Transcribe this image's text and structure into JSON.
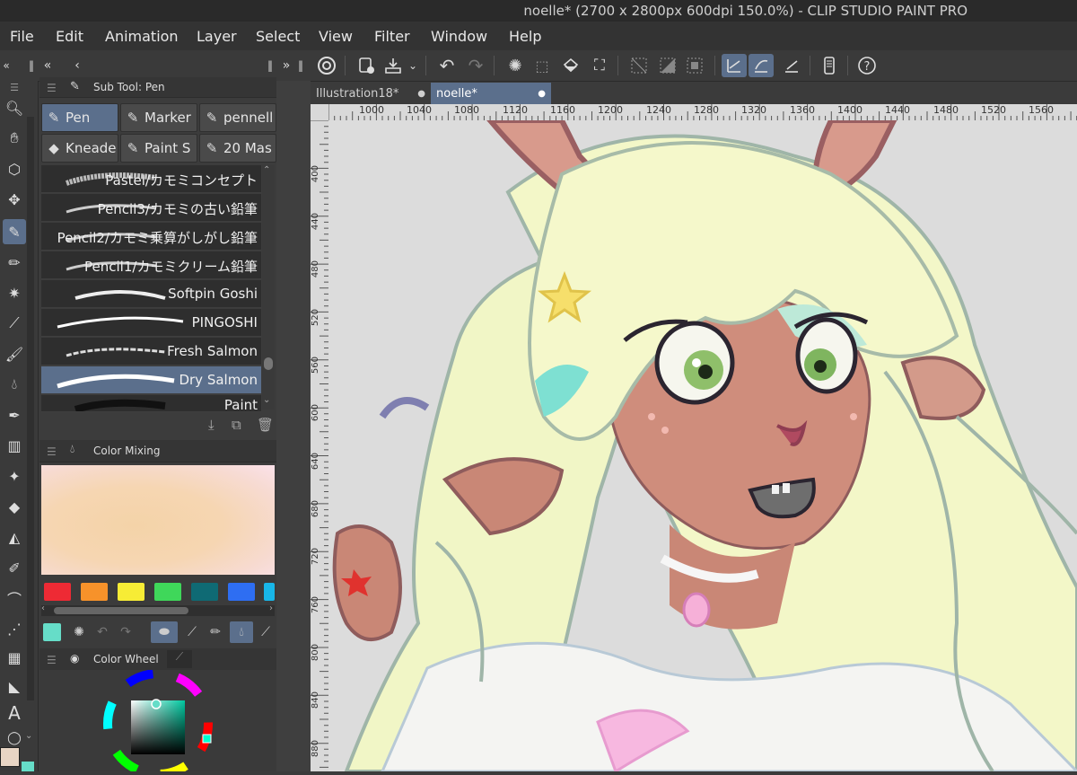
{
  "window": {
    "title": "noelle* (2700 x 2800px 600dpi 150.0%)  - CLIP STUDIO PAINT PRO"
  },
  "menu": [
    "File",
    "Edit",
    "Animation",
    "Layer",
    "Select",
    "View",
    "Filter",
    "Window",
    "Help"
  ],
  "subtool_panel": {
    "title": "Sub Tool: Pen",
    "tabs": [
      "Pen",
      "Marker",
      "pennell",
      "Kneade",
      "Paint S",
      "20 Mas"
    ],
    "brushes": [
      "Pastel/カモミコンセプト",
      "Pencil3/カモミの古い鉛筆",
      "Pencil2/カモミ乗算がしがし鉛筆",
      "Pencil1/カモミクリーム鉛筆",
      "Softpin Goshi",
      "PINGOSHI",
      "Fresh Salmon",
      "Dry Salmon",
      "Paint"
    ],
    "active_brush": "Dry Salmon"
  },
  "color_mixing": {
    "title": "Color Mixing",
    "swatches": [
      "#ee2a34",
      "#f7922a",
      "#f7ec35",
      "#3fd75a",
      "#0f6a74",
      "#2e6ef2",
      "#18b6e8"
    ]
  },
  "color_wheel": {
    "title": "Color Wheel"
  },
  "document_tabs": [
    "Illustration18*",
    "noelle*"
  ],
  "active_document": "noelle*",
  "ruler_top": [
    "1000",
    "1040",
    "1080",
    "1120",
    "1160",
    "1200",
    "1240",
    "1280",
    "1320",
    "1360",
    "1400",
    "1440",
    "1480",
    "1520",
    "1560"
  ],
  "ruler_left": [
    "400",
    "440",
    "480",
    "520",
    "560",
    "600",
    "640",
    "680",
    "720",
    "760",
    "800",
    "840",
    "880"
  ],
  "colors": {
    "accent": "#5b6f8c",
    "main": "#e8d5c4",
    "sub": "#66ddc8"
  }
}
